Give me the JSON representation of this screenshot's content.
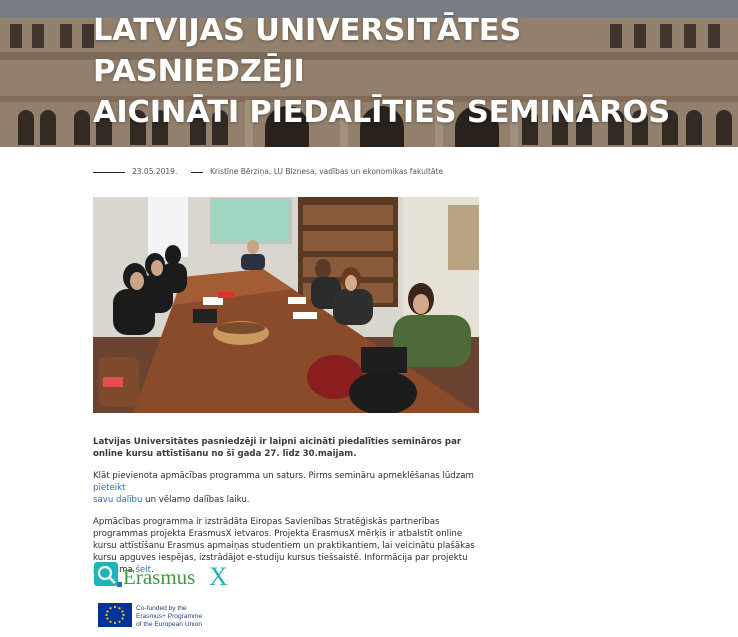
{
  "hero": {
    "title_line1": "LATVIJAS UNIVERSITĀTES PASNIEDZĒJI",
    "title_line2": "AICINĀTI PIEDALĪTIES SEMINĀROS"
  },
  "meta": {
    "date": "23.05.2019.",
    "author": "Kristīne Bērziņa, LU Biznesa, vadības un ekonomikas fakultāte"
  },
  "body": {
    "lead": "Latvijas Universitātes pasniedzēji ir laipni aicināti piedalīties semināros par online kursu attīstīšanu no šī gada 27. līdz 30.maijam.",
    "p2_part1": "Klāt pievienota apmācības programma un saturs. Pirms semināru apmeklēšanas lūdzam ",
    "p2_link": "pieteikt",
    "p2_link2": "savu dalību",
    "p2_part2": " un vēlamo dalības laiku.",
    "p3_part1": "Apmācības programma ir izstrādāta Eiropas Savienības Stratēģiskās partnerības programmas projekta ErasmusX ietvaros. Projekta ErasmusX mērķis ir atbalstīt online kursu attīstīšanu Erasmus apmaiņas studentiem un praktikantiem, lai veicinātu plašākas kursu apguves iespējas, izstrādājot e-studiju kursus tiešsaistē. Informācija par projektu pieejama ",
    "p3_link": "šeit",
    "p3_part2": "."
  },
  "logos": {
    "erasmusx_word": "Erasmus",
    "erasmusx_x": "X",
    "eu_line1": "Co-funded by the",
    "eu_line2": "Erasmus+ Programme",
    "eu_line3": "of the European Union"
  },
  "colors": {
    "link": "#2f6fb0",
    "erasmus_green": "#3f9a3c",
    "erasmus_teal": "#1fb4b8",
    "eu_blue": "#003399",
    "eu_star": "#ffcc00"
  },
  "icons": {
    "photo_icon": "hero-building-image",
    "meeting_photo": "seminar-meeting-photo"
  }
}
